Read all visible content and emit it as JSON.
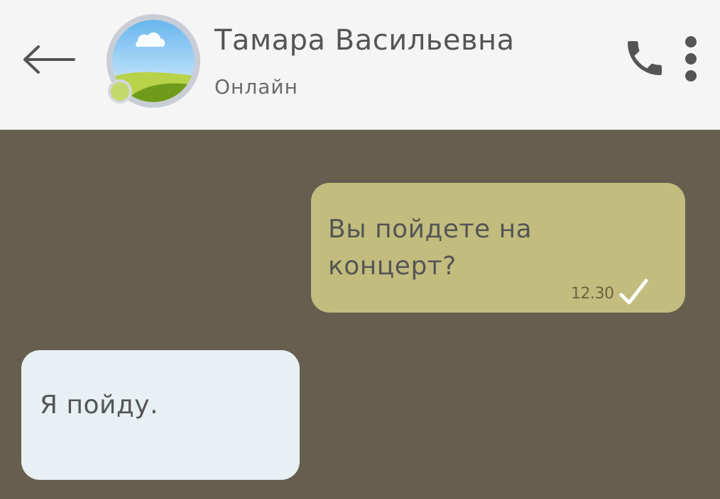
{
  "header": {
    "contact_name": "Тамара Васильевна",
    "contact_status": "Онлайн",
    "back_icon": "arrow-left-icon",
    "call_icon": "phone-icon",
    "menu_icon": "more-vertical-icon",
    "status_color": "#c5d86d"
  },
  "chat": {
    "background_color": "#665f50",
    "messages": [
      {
        "direction": "outgoing",
        "text": "Вы пойдете на концерт?",
        "time": "12.30",
        "status_icon": "check-icon",
        "bubble_color": "#c2bd7e"
      },
      {
        "direction": "incoming",
        "text": "Я пойду.",
        "bubble_color": "#e8f0f4"
      }
    ]
  }
}
